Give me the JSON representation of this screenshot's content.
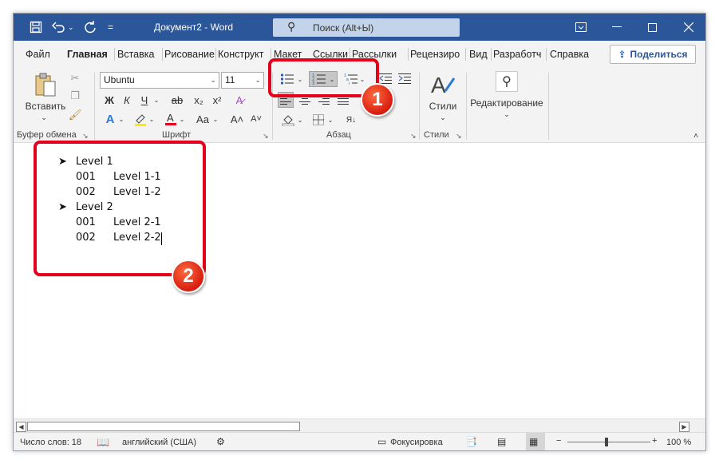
{
  "titlebar": {
    "icons": [
      "save-icon",
      "undo-icon",
      "redo-icon",
      "customize-qat-icon"
    ],
    "doc_title": "Документ2  -  Word",
    "search_placeholder": "Поиск (Alt+Ы)"
  },
  "tabs": [
    "Файл",
    "Главная",
    "Вставка",
    "Рисование",
    "Конструкт",
    "Макет",
    "Ссылки",
    "Рассылки",
    "Рецензиро",
    "Вид",
    "Разработч",
    "Справка"
  ],
  "share_label": "Поделиться",
  "ribbon": {
    "clipboard": {
      "paste_label": "Вставить",
      "group_label": "Буфер обмена"
    },
    "font": {
      "font_name": "Ubuntu",
      "font_size": "11",
      "group_label": "Шрифт",
      "bold": "Ж",
      "italic": "К",
      "underline": "Ч",
      "strike": "ab",
      "sub": "x₂",
      "sup": "x²",
      "clear": "A",
      "grow": "A^",
      "shrink": "Aˇ",
      "case": "Aa"
    },
    "paragraph": {
      "group_label": "Абзац"
    },
    "styles": {
      "label": "Стили",
      "group_label": "Стили"
    },
    "editing": {
      "label": "Редактирование"
    }
  },
  "document": {
    "lines": [
      {
        "marker": "➤",
        "text": "Level 1"
      },
      {
        "marker": "001",
        "text": "Level 1-1"
      },
      {
        "marker": "002",
        "text": "Level 1-2"
      },
      {
        "marker": "➤",
        "text": "Level 2"
      },
      {
        "marker": "001",
        "text": "Level 2-1"
      },
      {
        "marker": "002",
        "text": "Level 2-2"
      }
    ]
  },
  "status": {
    "word_count": "Число слов: 18",
    "language": "английский (США)",
    "focus": "Фокусировка",
    "zoom": "100 %"
  },
  "callouts": [
    "1",
    "2"
  ],
  "colors": {
    "titlebar": "#2b579a",
    "callout": "#e3001b"
  }
}
